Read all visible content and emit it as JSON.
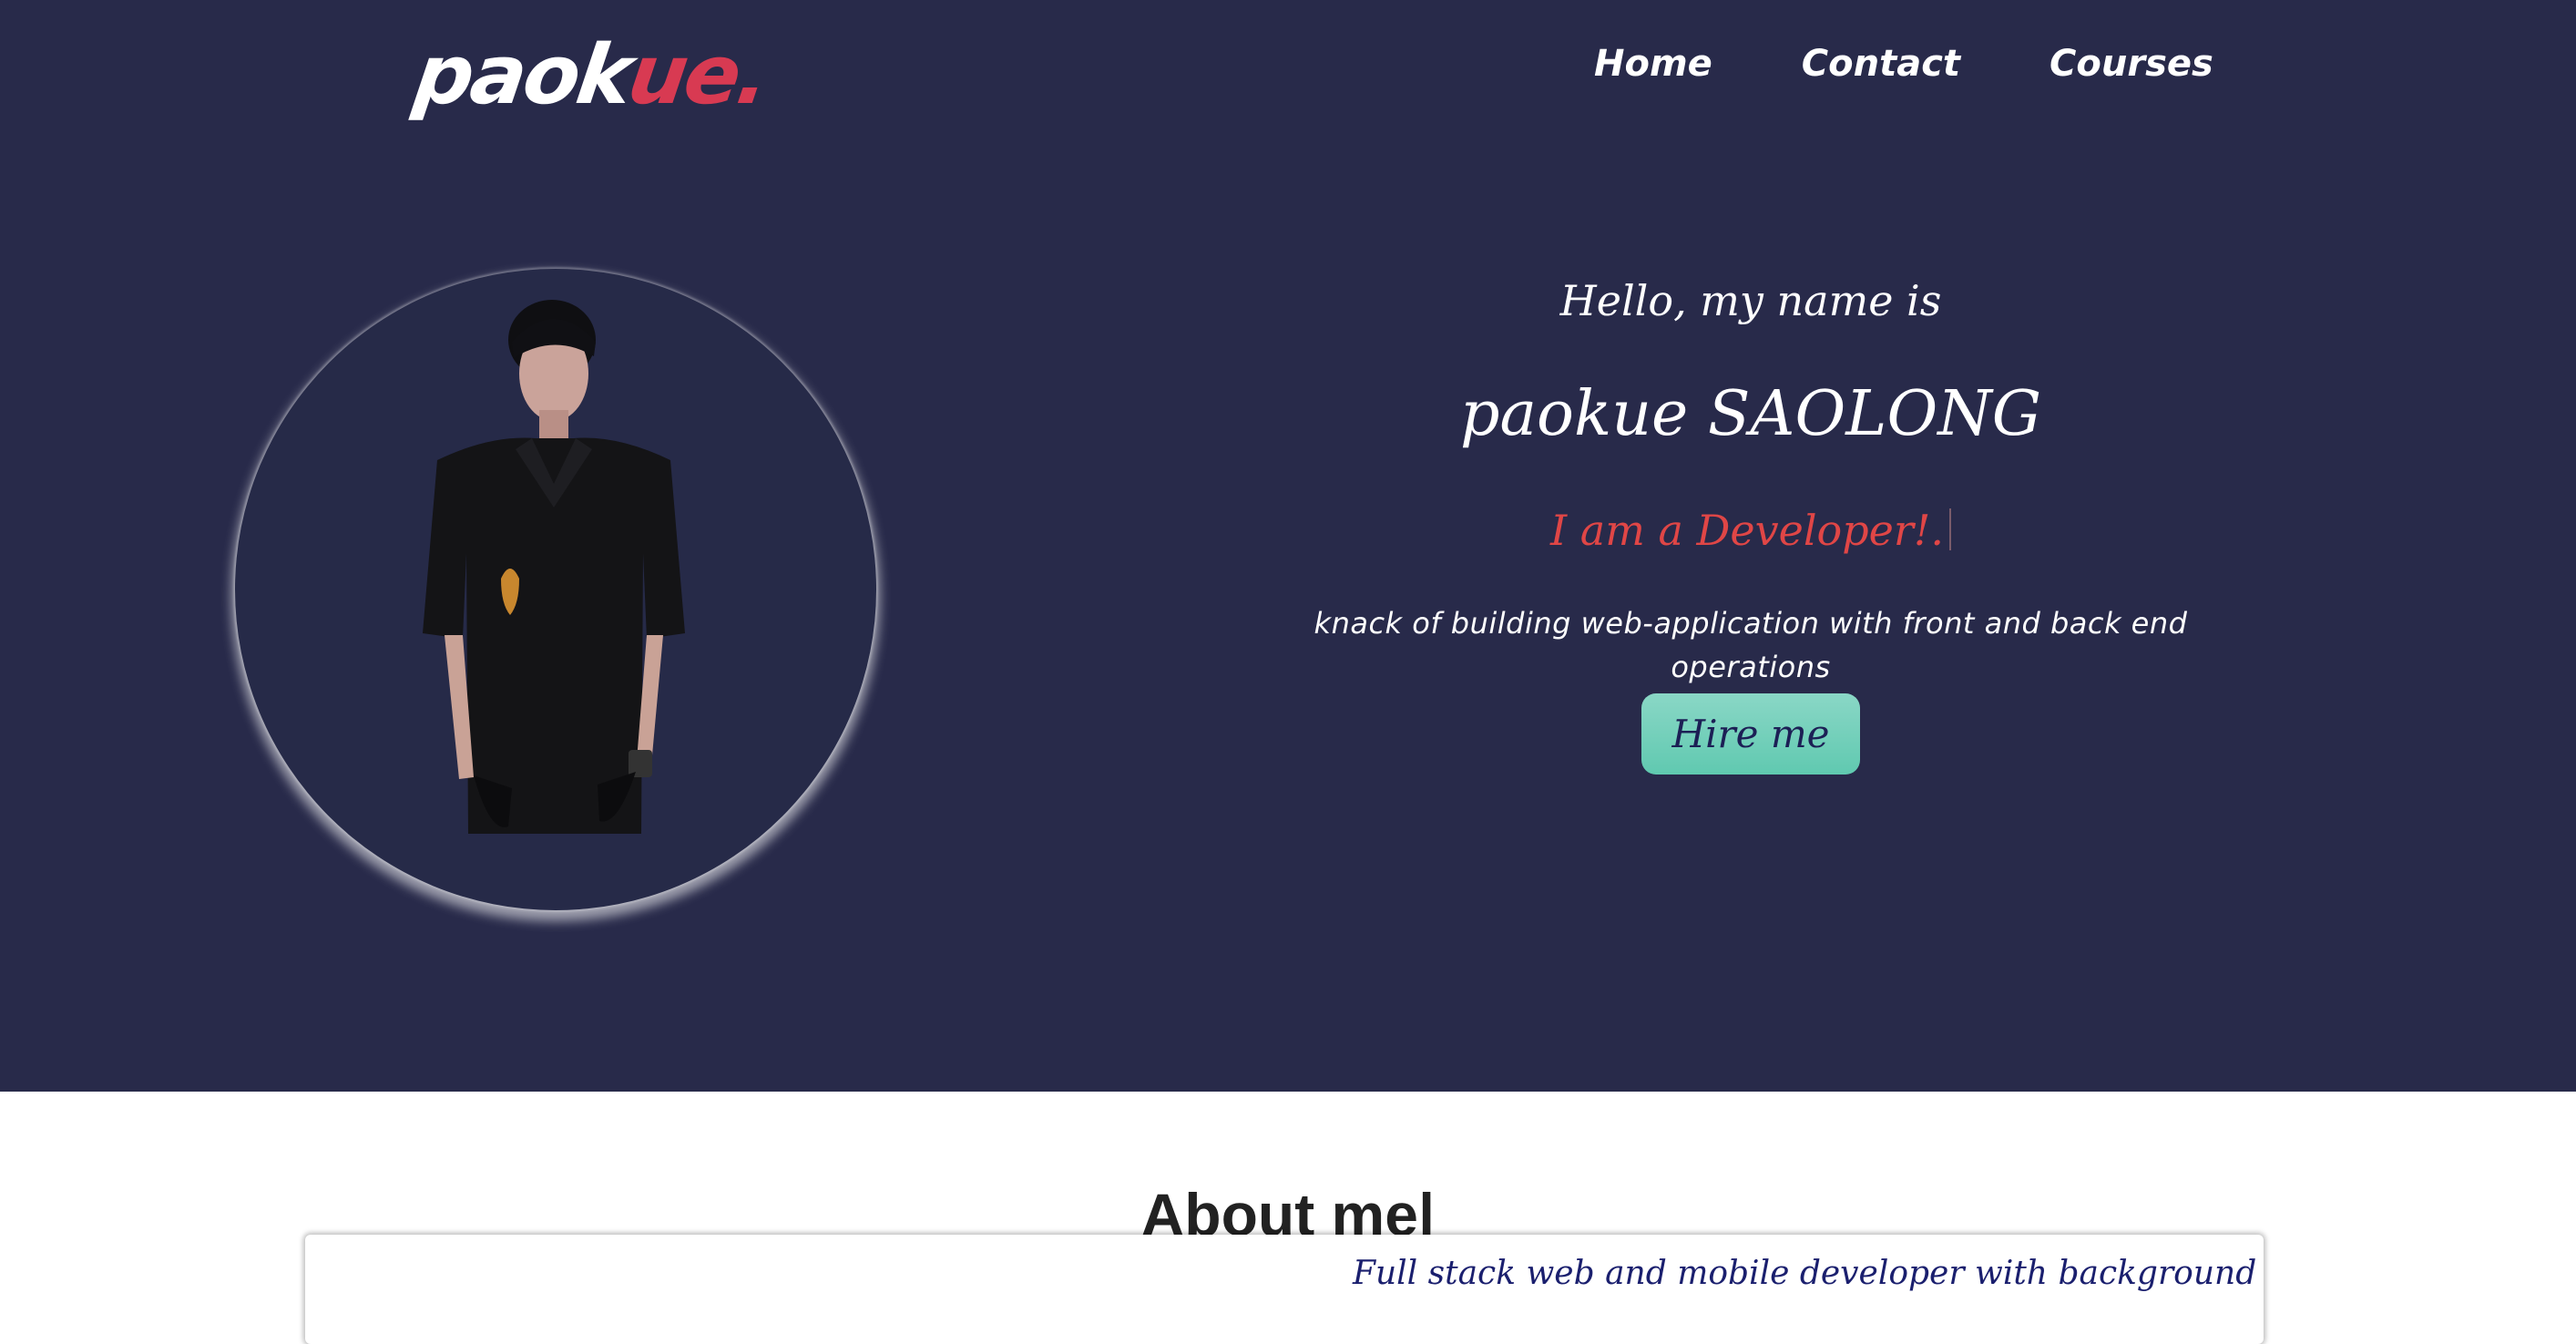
{
  "header": {
    "logo_main": "paok",
    "logo_accent": "ue.",
    "nav": [
      "Home",
      "Contact",
      "Courses"
    ]
  },
  "hero": {
    "greeting": "Hello, my name is",
    "name": "paokue SAOLONG",
    "role": "I am a Developer!.",
    "tagline": "knack of building web-application with front and back end operations",
    "cta_label": "Hire me"
  },
  "about": {
    "title": "About me|",
    "text": "Full stack web and mobile developer with background knowledge of"
  },
  "colors": {
    "hero_bg": "#282a4a",
    "accent": "#d83a52",
    "role": "#e04646",
    "button": "#6fcfb8",
    "button_text": "#1c1f55"
  }
}
